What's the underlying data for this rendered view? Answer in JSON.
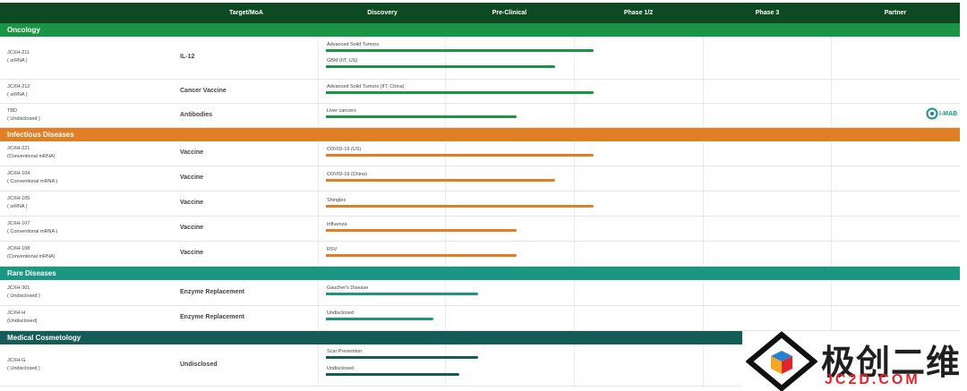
{
  "header": {
    "columns": [
      "Target/MoA",
      "Discovery",
      "Pre-Clinical",
      "Phase 1/2",
      "Phase 3",
      "Partner"
    ]
  },
  "colors": {
    "header": "#0d4a22",
    "oncology": "#1b9446",
    "infectious": "#e07f26",
    "rare": "#1a9683",
    "cosmetology": "#155c58"
  },
  "chart_data": {
    "type": "table",
    "stages": [
      "Discovery",
      "Pre-Clinical",
      "Phase 1/2",
      "Phase 3"
    ],
    "sections": [
      {
        "name": "Oncology",
        "color": "#1b9446",
        "rows": [
          {
            "code": "JCXH-211",
            "platform": "( srRNA )",
            "target": "IL-12",
            "indications": [
              {
                "label": "Advanced Solid Tumors",
                "progress": 2.1
              },
              {
                "label": "GBM (IIT, US)",
                "progress": 1.8
              }
            ]
          },
          {
            "code": "JCXH-212",
            "platform": "( srRNA )",
            "target": "Cancer Vaccine",
            "indications": [
              {
                "label": "Advanced Solid Tumors (IIT, China)",
                "progress": 2.1
              }
            ]
          },
          {
            "code": "TBD",
            "platform": "( Undisclosed )",
            "target": "Antibodies",
            "indications": [
              {
                "label": "Liver cancers",
                "progress": 1.5
              }
            ],
            "partner": "I-MAB"
          }
        ]
      },
      {
        "name": "Infectious Diseases",
        "color": "#e07f26",
        "rows": [
          {
            "code": "JCXH-221",
            "platform": "(Conventional mRNA)",
            "target": "Vaccine",
            "indications": [
              {
                "label": "COVID-19 (US)",
                "progress": 2.1
              }
            ]
          },
          {
            "code": "JCXH-104",
            "platform": "( Conventional mRNA )",
            "target": "Vaccine",
            "indications": [
              {
                "label": "COVID-19 (China)",
                "progress": 1.8
              }
            ]
          },
          {
            "code": "JCXH-105",
            "platform": "( srRNA )",
            "target": "Vaccine",
            "indications": [
              {
                "label": "Shingles",
                "progress": 2.1
              }
            ]
          },
          {
            "code": "JCXH-107",
            "platform": "( Conventional mRNA )",
            "target": "Vaccine",
            "indications": [
              {
                "label": "Influenza",
                "progress": 1.5
              }
            ]
          },
          {
            "code": "JCXH-108",
            "platform": "(Conventional mRNA)",
            "target": "Vaccine",
            "indications": [
              {
                "label": "RSV",
                "progress": 1.5
              }
            ]
          }
        ]
      },
      {
        "name": "Rare Diseases",
        "color": "#1a9683",
        "rows": [
          {
            "code": "JCXH-301",
            "platform": "( Undisclosed )",
            "target": "Enzyme Replacement",
            "indications": [
              {
                "label": "Gaucher's Disease",
                "progress": 1.2
              }
            ]
          },
          {
            "code": "JCXH-H",
            "platform": "(Undisclosed)",
            "target": "Enzyme Replacement",
            "indications": [
              {
                "label": "Undisclosed",
                "progress": 0.85
              }
            ]
          }
        ]
      },
      {
        "name": "Medical Cosmetology",
        "color": "#155c58",
        "rows": [
          {
            "code": "JCXH-G",
            "platform": "( Undisclosed )",
            "target": "Undisclosed",
            "indications": [
              {
                "label": "Scar Prevention",
                "progress": 1.2
              },
              {
                "label": "Undisclosed",
                "progress": 1.05
              }
            ]
          }
        ]
      }
    ]
  },
  "watermark": {
    "text": "极创二维",
    "sub": "JC2D.COM"
  }
}
